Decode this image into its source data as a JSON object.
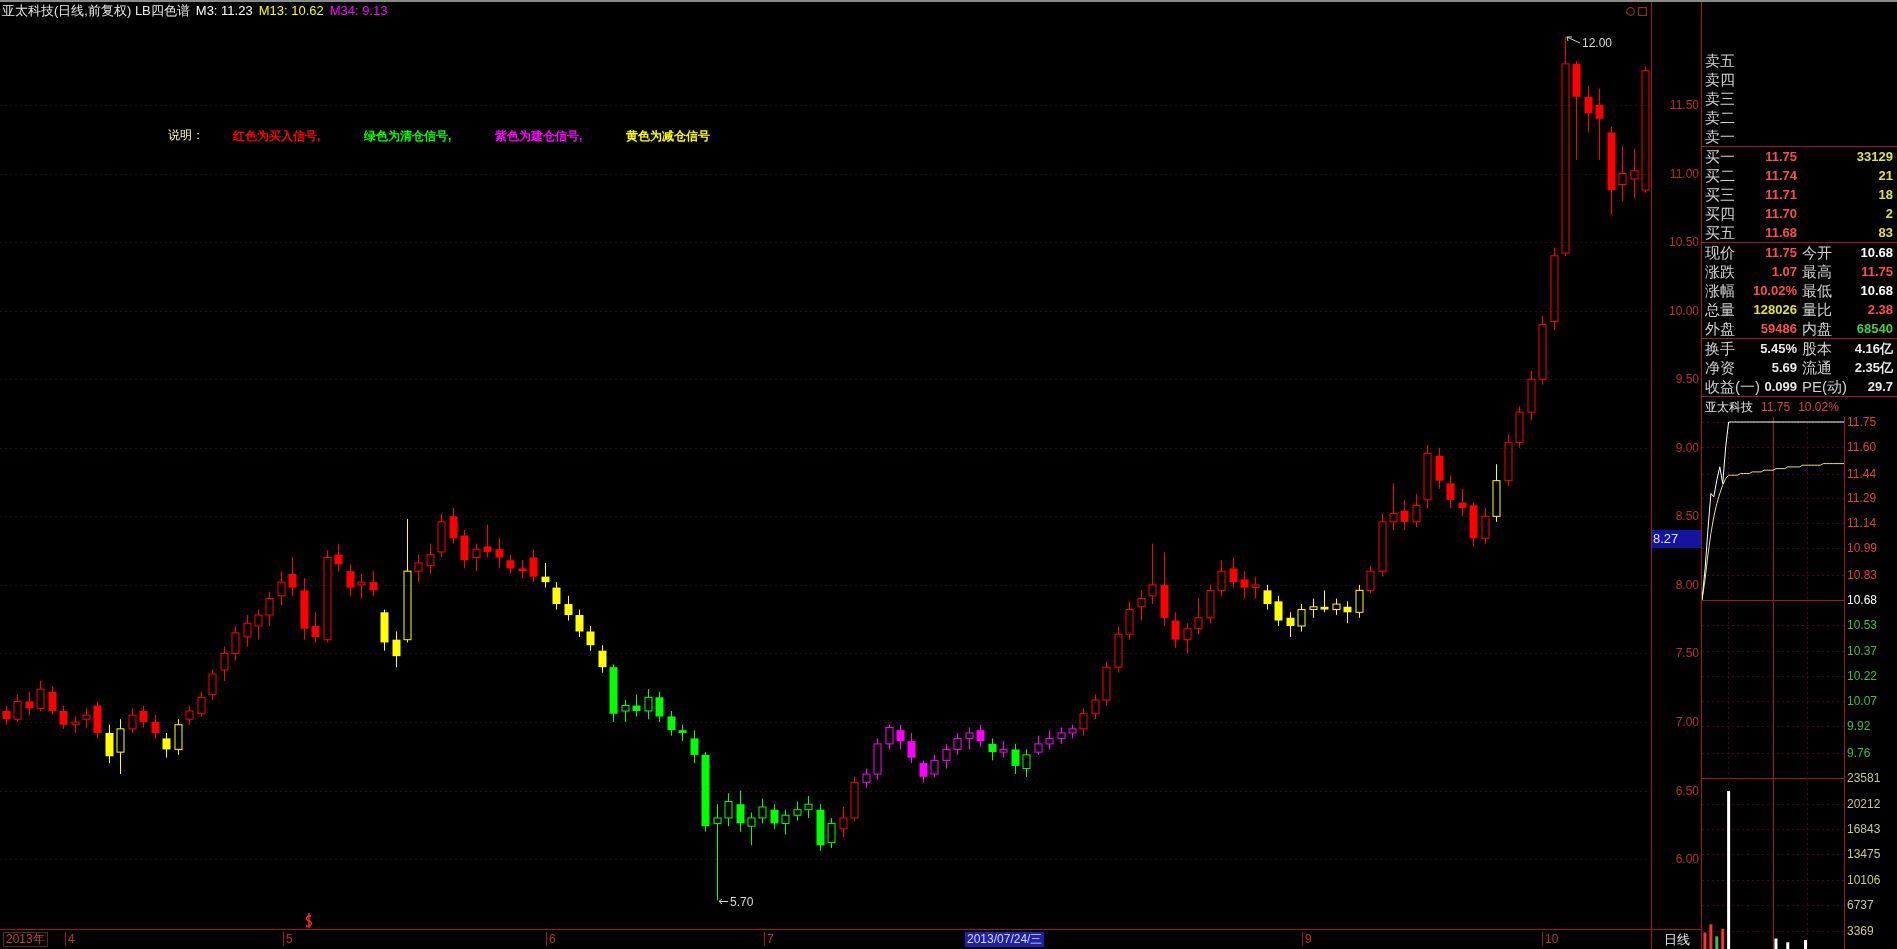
{
  "header": {
    "title": "亚太科技(日线,前复权) LB四色谱",
    "indicators": [
      {
        "label": "M3: 11.23",
        "color": "#ffffff"
      },
      {
        "label": "M13: 10.62",
        "color": "#ffff00"
      },
      {
        "label": "M34: 9.13",
        "color": "#ff00ff"
      }
    ]
  },
  "legend": {
    "title": "说明：",
    "items": [
      {
        "text": "红色为买入信号,",
        "color": "#ff0000"
      },
      {
        "text": "绿色为清仓信号,",
        "color": "#00ff00"
      },
      {
        "text": "紫色为建仓信号,",
        "color": "#ff00ff"
      },
      {
        "text": "黄色为减仓信号",
        "color": "#ffff00"
      }
    ]
  },
  "price_chart": {
    "high_label": "12.00",
    "low_label": "5.70",
    "cursor_price": "8.27",
    "chart_data": {
      "type": "candlestick",
      "categories": [
        null,
        null,
        null,
        null,
        null,
        null,
        null,
        null,
        null,
        null,
        null,
        null,
        null,
        null,
        null,
        null,
        null,
        null,
        null,
        null,
        null,
        null,
        null,
        null,
        null,
        null,
        null,
        null,
        null,
        null,
        null,
        null,
        null,
        null,
        null,
        null,
        null,
        null,
        null,
        null,
        null,
        null,
        null,
        null,
        null,
        null,
        null,
        null,
        null,
        null,
        null,
        null,
        null,
        null,
        null,
        null,
        null,
        null,
        null,
        null,
        null,
        null,
        null,
        null,
        null,
        null,
        null,
        null,
        null,
        null,
        null,
        null,
        null,
        null,
        null,
        null,
        null,
        null,
        null,
        null,
        null,
        null,
        null,
        null,
        null,
        null,
        null,
        null,
        null,
        null,
        null,
        null,
        null,
        null,
        null,
        null,
        null,
        null,
        null,
        null,
        null,
        null,
        null,
        null,
        null,
        null,
        null,
        null,
        null,
        null,
        null,
        null,
        null,
        null,
        null,
        null,
        null,
        null,
        null,
        null,
        null,
        null,
        null,
        null,
        null,
        null,
        null,
        null,
        null,
        null,
        null,
        null,
        null,
        null,
        null,
        null,
        null,
        null,
        null,
        null,
        null,
        null,
        null,
        null
      ],
      "ohlc": [
        [
          7.08,
          7.12,
          6.98,
          7.02
        ],
        [
          7.02,
          7.2,
          7.0,
          7.15
        ],
        [
          7.15,
          7.22,
          7.05,
          7.1
        ],
        [
          7.1,
          7.3,
          7.08,
          7.24
        ],
        [
          7.22,
          7.26,
          7.05,
          7.08
        ],
        [
          7.08,
          7.12,
          6.95,
          6.98
        ],
        [
          6.98,
          7.04,
          6.92,
          7.0
        ],
        [
          7.02,
          7.1,
          6.96,
          7.05
        ],
        [
          7.12,
          7.15,
          6.88,
          6.92
        ],
        [
          6.92,
          6.98,
          6.7,
          6.75
        ],
        [
          6.78,
          7.02,
          6.62,
          6.95
        ],
        [
          6.95,
          7.1,
          6.92,
          7.05
        ],
        [
          7.08,
          7.12,
          6.96,
          7.0
        ],
        [
          7.0,
          7.05,
          6.88,
          6.92
        ],
        [
          6.88,
          6.92,
          6.74,
          6.8
        ],
        [
          6.8,
          7.02,
          6.76,
          6.98
        ],
        [
          7.02,
          7.12,
          6.98,
          7.08
        ],
        [
          7.06,
          7.22,
          7.04,
          7.18
        ],
        [
          7.2,
          7.38,
          7.16,
          7.35
        ],
        [
          7.38,
          7.55,
          7.3,
          7.5
        ],
        [
          7.5,
          7.7,
          7.45,
          7.65
        ],
        [
          7.62,
          7.78,
          7.55,
          7.72
        ],
        [
          7.7,
          7.82,
          7.6,
          7.78
        ],
        [
          7.78,
          7.95,
          7.7,
          7.9
        ],
        [
          7.92,
          8.1,
          7.85,
          8.02
        ],
        [
          8.08,
          8.2,
          7.92,
          7.98
        ],
        [
          7.96,
          8.05,
          7.6,
          7.68
        ],
        [
          7.7,
          7.8,
          7.58,
          7.62
        ],
        [
          7.6,
          8.25,
          7.58,
          8.2
        ],
        [
          8.22,
          8.3,
          8.1,
          8.15
        ],
        [
          8.1,
          8.15,
          7.92,
          7.98
        ],
        [
          8.0,
          8.08,
          7.9,
          8.02
        ],
        [
          8.02,
          8.1,
          7.92,
          7.96
        ],
        [
          7.8,
          7.82,
          7.52,
          7.58
        ],
        [
          7.6,
          7.66,
          7.4,
          7.48
        ],
        [
          7.6,
          8.48,
          7.58,
          8.1
        ],
        [
          8.1,
          8.22,
          8.02,
          8.16
        ],
        [
          8.14,
          8.3,
          8.08,
          8.22
        ],
        [
          8.24,
          8.52,
          8.2,
          8.46
        ],
        [
          8.5,
          8.56,
          8.3,
          8.34
        ],
        [
          8.36,
          8.4,
          8.12,
          8.18
        ],
        [
          8.2,
          8.3,
          8.1,
          8.26
        ],
        [
          8.28,
          8.44,
          8.2,
          8.24
        ],
        [
          8.26,
          8.34,
          8.12,
          8.2
        ],
        [
          8.18,
          8.22,
          8.08,
          8.12
        ],
        [
          8.12,
          8.18,
          8.05,
          8.1
        ],
        [
          8.2,
          8.26,
          8.02,
          8.06
        ],
        [
          8.06,
          8.16,
          7.98,
          8.02
        ],
        [
          7.98,
          8.02,
          7.82,
          7.86
        ],
        [
          7.86,
          7.92,
          7.74,
          7.78
        ],
        [
          7.78,
          7.82,
          7.62,
          7.66
        ],
        [
          7.66,
          7.7,
          7.52,
          7.56
        ],
        [
          7.52,
          7.56,
          7.36,
          7.4
        ],
        [
          7.4,
          7.42,
          7.0,
          7.06
        ],
        [
          7.08,
          7.16,
          7.0,
          7.12
        ],
        [
          7.12,
          7.2,
          7.04,
          7.08
        ],
        [
          7.08,
          7.24,
          7.02,
          7.18
        ],
        [
          7.18,
          7.22,
          7.0,
          7.04
        ],
        [
          7.04,
          7.08,
          6.9,
          6.94
        ],
        [
          6.94,
          6.98,
          6.86,
          6.92
        ],
        [
          6.88,
          6.94,
          6.7,
          6.76
        ],
        [
          6.76,
          6.78,
          6.2,
          6.24
        ],
        [
          6.26,
          6.4,
          5.7,
          6.3
        ],
        [
          6.3,
          6.48,
          6.24,
          6.42
        ],
        [
          6.4,
          6.5,
          6.2,
          6.26
        ],
        [
          6.24,
          6.34,
          6.1,
          6.3
        ],
        [
          6.3,
          6.44,
          6.26,
          6.38
        ],
        [
          6.36,
          6.4,
          6.22,
          6.26
        ],
        [
          6.26,
          6.36,
          6.18,
          6.32
        ],
        [
          6.32,
          6.42,
          6.28,
          6.36
        ],
        [
          6.36,
          6.46,
          6.3,
          6.4
        ],
        [
          6.36,
          6.4,
          6.06,
          6.1
        ],
        [
          6.12,
          6.3,
          6.08,
          6.26
        ],
        [
          6.22,
          6.38,
          6.16,
          6.3
        ],
        [
          6.3,
          6.6,
          6.28,
          6.56
        ],
        [
          6.56,
          6.66,
          6.52,
          6.62
        ],
        [
          6.62,
          6.88,
          6.58,
          6.84
        ],
        [
          6.84,
          6.98,
          6.8,
          6.96
        ],
        [
          6.94,
          6.98,
          6.8,
          6.86
        ],
        [
          6.86,
          6.92,
          6.7,
          6.74
        ],
        [
          6.7,
          6.72,
          6.56,
          6.6
        ],
        [
          6.62,
          6.76,
          6.6,
          6.72
        ],
        [
          6.72,
          6.84,
          6.66,
          6.8
        ],
        [
          6.8,
          6.92,
          6.76,
          6.88
        ],
        [
          6.88,
          6.96,
          6.8,
          6.92
        ],
        [
          6.94,
          6.98,
          6.82,
          6.86
        ],
        [
          6.84,
          6.88,
          6.72,
          6.78
        ],
        [
          6.78,
          6.86,
          6.74,
          6.8
        ],
        [
          6.8,
          6.84,
          6.62,
          6.68
        ],
        [
          6.66,
          6.8,
          6.6,
          6.76
        ],
        [
          6.78,
          6.9,
          6.76,
          6.84
        ],
        [
          6.84,
          6.94,
          6.8,
          6.88
        ],
        [
          6.88,
          6.96,
          6.84,
          6.92
        ],
        [
          6.92,
          6.98,
          6.88,
          6.95
        ],
        [
          6.95,
          7.1,
          6.9,
          7.06
        ],
        [
          7.06,
          7.2,
          7.02,
          7.16
        ],
        [
          7.16,
          7.44,
          7.12,
          7.4
        ],
        [
          7.4,
          7.7,
          7.36,
          7.64
        ],
        [
          7.64,
          7.88,
          7.6,
          7.82
        ],
        [
          7.84,
          7.96,
          7.74,
          7.9
        ],
        [
          7.92,
          8.3,
          7.86,
          8.0
        ],
        [
          8.0,
          8.24,
          7.7,
          7.76
        ],
        [
          7.74,
          7.8,
          7.54,
          7.6
        ],
        [
          7.6,
          7.72,
          7.5,
          7.68
        ],
        [
          7.68,
          7.9,
          7.64,
          7.76
        ],
        [
          7.76,
          8.0,
          7.72,
          7.96
        ],
        [
          7.96,
          8.18,
          7.92,
          8.1
        ],
        [
          8.12,
          8.2,
          7.98,
          8.02
        ],
        [
          8.04,
          8.1,
          7.9,
          7.98
        ],
        [
          7.98,
          8.06,
          7.9,
          8.0
        ],
        [
          7.96,
          8.0,
          7.82,
          7.86
        ],
        [
          7.88,
          7.92,
          7.7,
          7.74
        ],
        [
          7.76,
          7.8,
          7.62,
          7.7
        ],
        [
          7.7,
          7.86,
          7.66,
          7.82
        ],
        [
          7.82,
          7.9,
          7.76,
          7.84
        ],
        [
          7.84,
          7.96,
          7.8,
          7.82
        ],
        [
          7.82,
          7.9,
          7.78,
          7.86
        ],
        [
          7.84,
          7.88,
          7.72,
          7.8
        ],
        [
          7.8,
          8.0,
          7.76,
          7.96
        ],
        [
          7.96,
          8.14,
          7.94,
          8.1
        ],
        [
          8.1,
          8.52,
          8.06,
          8.46
        ],
        [
          8.46,
          8.74,
          8.4,
          8.52
        ],
        [
          8.54,
          8.62,
          8.4,
          8.46
        ],
        [
          8.46,
          8.66,
          8.42,
          8.58
        ],
        [
          8.62,
          9.02,
          8.56,
          8.96
        ],
        [
          8.94,
          9.0,
          8.7,
          8.76
        ],
        [
          8.74,
          8.8,
          8.56,
          8.62
        ],
        [
          8.6,
          8.7,
          8.5,
          8.56
        ],
        [
          8.58,
          8.6,
          8.28,
          8.34
        ],
        [
          8.34,
          8.56,
          8.3,
          8.5
        ],
        [
          8.5,
          8.88,
          8.46,
          8.76
        ],
        [
          8.76,
          9.1,
          8.72,
          9.04
        ],
        [
          9.04,
          9.3,
          9.0,
          9.26
        ],
        [
          9.26,
          9.56,
          9.2,
          9.5
        ],
        [
          9.5,
          9.96,
          9.46,
          9.9
        ],
        [
          9.92,
          10.46,
          9.86,
          10.4
        ],
        [
          10.42,
          12.0,
          10.4,
          11.8
        ],
        [
          11.8,
          11.82,
          11.1,
          11.56
        ],
        [
          11.56,
          11.64,
          11.3,
          11.44
        ],
        [
          11.5,
          11.62,
          11.1,
          11.4
        ],
        [
          11.3,
          11.34,
          10.7,
          10.88
        ],
        [
          10.92,
          11.2,
          10.8,
          11.0
        ],
        [
          10.96,
          11.18,
          10.82,
          11.02
        ],
        [
          10.88,
          11.78,
          10.86,
          11.75
        ]
      ],
      "colors": [
        "#ff0000",
        "#ff0000",
        "#ff0000",
        "#ff0000",
        "#ff0000",
        "#ff0000",
        "#ff0000",
        "#ff0000",
        "#ff0000",
        "#ffff00",
        "#ffff00",
        "#ff0000",
        "#ff0000",
        "#ff0000",
        "#ffff00",
        "#ffff00",
        "#ff0000",
        "#ff0000",
        "#ff0000",
        "#ff0000",
        "#ff0000",
        "#ff0000",
        "#ff0000",
        "#ff0000",
        "#ff0000",
        "#ff0000",
        "#ff0000",
        "#ff0000",
        "#ff0000",
        "#ff0000",
        "#ff0000",
        "#ff0000",
        "#ff0000",
        "#ffff00",
        "#ffff00",
        "#ffff00",
        "#ff0000",
        "#ff0000",
        "#ff0000",
        "#ff0000",
        "#ff0000",
        "#ff0000",
        "#ff0000",
        "#ff0000",
        "#ff0000",
        "#ff0000",
        "#ff0000",
        "#ffff00",
        "#ffff00",
        "#ffff00",
        "#ffff00",
        "#ffff00",
        "#ffff00",
        "#00ff00",
        "#00ff00",
        "#00ff00",
        "#00ff00",
        "#00ff00",
        "#00ff00",
        "#00ff00",
        "#00ff00",
        "#00ff00",
        "#00ff00",
        "#00ff00",
        "#00ff00",
        "#00ff00",
        "#00ff00",
        "#00ff00",
        "#00ff00",
        "#00ff00",
        "#00ff00",
        "#00ff00",
        "#00ff00",
        "#ff0000",
        "#ff0000",
        "#ff00ff",
        "#ff00ff",
        "#ff00ff",
        "#ff00ff",
        "#ff00ff",
        "#ff00ff",
        "#ff00ff",
        "#ff00ff",
        "#ff00ff",
        "#ff00ff",
        "#ff00ff",
        "#00ff00",
        "#ff00ff",
        "#00ff00",
        "#00ff00",
        "#ff00ff",
        "#ff00ff",
        "#ff00ff",
        "#ff00ff",
        "#ff0000",
        "#ff0000",
        "#ff0000",
        "#ff0000",
        "#ff0000",
        "#ff0000",
        "#ff0000",
        "#ff0000",
        "#ff0000",
        "#ff0000",
        "#ff0000",
        "#ff0000",
        "#ff0000",
        "#ff0000",
        "#ff0000",
        "#ff0000",
        "#ffff00",
        "#ffff00",
        "#ffff00",
        "#ffff00",
        "#ffff00",
        "#ffff00",
        "#ffff00",
        "#ffff00",
        "#ffff00",
        "#ff0000",
        "#ff0000",
        "#ff0000",
        "#ff0000",
        "#ff0000",
        "#ff0000",
        "#ff0000",
        "#ff0000",
        "#ff0000",
        "#ff0000",
        "#ff0000",
        "#ffff00",
        "#ff0000",
        "#ff0000",
        "#ff0000",
        "#ff0000",
        "#ff0000",
        "#ff0000",
        "#ff0000",
        "#ff0000",
        "#ff0000",
        "#ff0000",
        "#ff0000",
        "#ff0000",
        "#ff0000"
      ],
      "ylim": [
        5.49,
        12.12
      ],
      "yticks": [
        {
          "value": 11.5,
          "label": "11.50"
        },
        {
          "value": 11,
          "label": "11.00"
        },
        {
          "value": 10.5,
          "label": "10.50"
        },
        {
          "value": 10,
          "label": "10.00"
        },
        {
          "value": 9.5,
          "label": "9.50"
        },
        {
          "value": 9,
          "label": "9.00"
        },
        {
          "value": 8.5,
          "label": "8.50"
        },
        {
          "value": 8,
          "label": "8.00"
        },
        {
          "value": 7.5,
          "label": "7.50"
        },
        {
          "value": 7,
          "label": "7.00"
        },
        {
          "value": 6.5,
          "label": "6.50"
        },
        {
          "value": 6,
          "label": "6.00"
        }
      ],
      "grid": true
    }
  },
  "time_axis": {
    "year": "2013年",
    "months": [
      "4",
      "5",
      "6",
      "7",
      "9",
      "10"
    ],
    "cursor_date": "2013/07/24/三",
    "period": "日线"
  },
  "order_book": {
    "asks": [
      {
        "label": "卖五"
      },
      {
        "label": "卖四"
      },
      {
        "label": "卖三"
      },
      {
        "label": "卖二"
      },
      {
        "label": "卖一"
      }
    ],
    "bids": [
      {
        "label": "买一",
        "price": "11.75",
        "volume": "33129"
      },
      {
        "label": "买二",
        "price": "11.74",
        "volume": "21"
      },
      {
        "label": "买三",
        "price": "11.71",
        "volume": "18"
      },
      {
        "label": "买四",
        "price": "11.70",
        "volume": "2"
      },
      {
        "label": "买五",
        "price": "11.68",
        "volume": "83"
      }
    ]
  },
  "stats": [
    {
      "cells": [
        {
          "label": "现价",
          "value": "11.75",
          "color": "#ff4d4d"
        },
        {
          "label": "今开",
          "value": "10.68",
          "color": "#ffffff"
        },
        {
          "label": "涨跌",
          "value": "1.07",
          "color": "#ff4d4d"
        },
        {
          "label": "最高",
          "value": "11.75",
          "color": "#ff4d4d"
        },
        {
          "label": "涨幅",
          "value": "10.02%",
          "color": "#ff4d4d"
        },
        {
          "label": "最低",
          "value": "10.68",
          "color": "#ffffff"
        },
        {
          "label": "总量",
          "value": "128026",
          "color": "#e0e040"
        },
        {
          "label": "量比",
          "value": "2.38",
          "color": "#ff4d4d"
        },
        {
          "label": "外盘",
          "value": "59486",
          "color": "#ff4d4d"
        },
        {
          "label": "内盘",
          "value": "68540",
          "color": "#40d040"
        }
      ]
    },
    {
      "cells": [
        {
          "label": "换手",
          "value": "5.45%",
          "color": "#e8e8e8"
        },
        {
          "label": "股本",
          "value": "4.16亿",
          "color": "#e8e8e8"
        },
        {
          "label": "净资",
          "value": "5.69",
          "color": "#e8e8e8"
        },
        {
          "label": "流通",
          "value": "2.35亿",
          "color": "#e8e8e8"
        },
        {
          "label": "收益(一)",
          "value": "0.099",
          "color": "#e8e8e8"
        },
        {
          "label": "PE(动)",
          "value": "29.7",
          "color": "#e8e8e8"
        }
      ]
    }
  ],
  "intraday": {
    "name": "亚太科技",
    "price": "11.75",
    "change": "10.02%",
    "price_panel": {
      "chart_data": {
        "type": "line",
        "categories": [
          null,
          null,
          null,
          null,
          null,
          null,
          null,
          null,
          null,
          null,
          null,
          null,
          null,
          null,
          null,
          null,
          null,
          null,
          null,
          null,
          null,
          null,
          null,
          null,
          null,
          null,
          null,
          null,
          null,
          null,
          null,
          null,
          null,
          null,
          null,
          null,
          null,
          null,
          null,
          null,
          null,
          null,
          null,
          null,
          null,
          null,
          null,
          null,
          null
        ],
        "series": [
          {
            "color": "#ffffff",
            "values": [
              10.68,
              10.86,
              11.1,
              11.32,
              11.3,
              11.4,
              11.48,
              11.38,
              11.6,
              11.75,
              11.75,
              11.75,
              11.75,
              11.75,
              11.75,
              11.75,
              11.75,
              11.75,
              11.75,
              11.75,
              11.75,
              11.75,
              11.75,
              11.75,
              11.75,
              11.75,
              11.75,
              11.75,
              11.75,
              11.75,
              11.75,
              11.75,
              11.75,
              11.75,
              11.75,
              11.75,
              11.75,
              11.75,
              11.75,
              11.75,
              11.75,
              11.75,
              11.75,
              11.75,
              11.75,
              11.75,
              11.75,
              11.75,
              11.75
            ]
          },
          {
            "color": "#e8e070",
            "values": [
              10.68,
              10.8,
              10.95,
              11.08,
              11.18,
              11.26,
              11.32,
              11.37,
              11.41,
              11.43,
              11.43,
              11.43,
              11.43,
              11.44,
              11.44,
              11.44,
              11.44,
              11.45,
              11.45,
              11.45,
              11.45,
              11.46,
              11.46,
              11.46,
              11.46,
              11.47,
              11.47,
              11.47,
              11.47,
              11.48,
              11.48,
              11.48,
              11.48,
              11.48,
              11.49,
              11.49,
              11.49,
              11.49,
              11.49,
              11.49,
              11.49,
              11.5,
              11.5,
              11.5,
              11.5,
              11.5,
              11.5,
              11.5,
              11.5
            ]
          }
        ],
        "ylim": [
          9.76,
          11.75
        ],
        "yticks": [
          {
            "value": 11.75,
            "label": "11.75"
          },
          {
            "value": 11.6,
            "label": "11.60"
          },
          {
            "value": 11.44,
            "label": "11.44"
          },
          {
            "value": 11.29,
            "label": "11.29"
          },
          {
            "value": 11.14,
            "label": "11.14"
          },
          {
            "value": 10.99,
            "label": "10.99"
          },
          {
            "value": 10.83,
            "label": "10.83"
          },
          {
            "value": 10.68,
            "label": "10.68"
          },
          {
            "value": 10.53,
            "label": "10.53"
          },
          {
            "value": 10.37,
            "label": "10.37"
          },
          {
            "value": 10.22,
            "label": "10.22"
          },
          {
            "value": 10.07,
            "label": "10.07"
          },
          {
            "value": 9.92,
            "label": "9.92"
          },
          {
            "value": 9.76,
            "label": "9.76"
          }
        ],
        "grid": true
      }
    },
    "volume_panel": {
      "chart_data": {
        "type": "bar",
        "categories": [
          null,
          null,
          null,
          null,
          null,
          null,
          null,
          null,
          null,
          null,
          null,
          null,
          null,
          null,
          null,
          null,
          null,
          null,
          null,
          null,
          null,
          null,
          null,
          null
        ],
        "series": [
          {
            "color": "#ff3030",
            "values": [
              3100,
              4200,
              null,
              3600,
              null,
              null,
              null,
              null,
              null,
              null,
              null,
              null,
              null,
              null,
              null,
              null,
              null,
              null,
              null,
              null,
              null,
              null,
              null,
              null
            ]
          },
          {
            "color": "#40c040",
            "values": [
              null,
              null,
              2600,
              null,
              null,
              null,
              null,
              null,
              null,
              null,
              null,
              null,
              null,
              null,
              null,
              null,
              null,
              null,
              null,
              null,
              null,
              null,
              null,
              null
            ]
          },
          {
            "color": "#ffffff",
            "values": [
              null,
              null,
              null,
              null,
              21900,
              null,
              null,
              null,
              null,
              null,
              null,
              null,
              2300,
              null,
              1800,
              null,
              null,
              2100,
              null,
              null,
              null,
              null,
              null,
              null
            ]
          }
        ],
        "ylim": [
          915,
          23581
        ],
        "yticks": [
          {
            "value": 23581,
            "label": "23581"
          },
          {
            "value": 20212,
            "label": "20212"
          },
          {
            "value": 16843,
            "label": "16843"
          },
          {
            "value": 13475,
            "label": "13475"
          },
          {
            "value": 10106,
            "label": "10106"
          },
          {
            "value": 6737,
            "label": "6737"
          },
          {
            "value": 3369,
            "label": "3369"
          }
        ],
        "grid": true
      }
    }
  }
}
